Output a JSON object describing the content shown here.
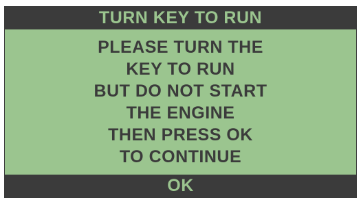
{
  "screen": {
    "title": "TURN KEY TO RUN",
    "message_lines": [
      "PLEASE TURN THE",
      "KEY TO RUN",
      "BUT DO NOT START",
      "THE ENGINE",
      "THEN PRESS OK",
      "TO CONTINUE"
    ],
    "ok_label": "OK"
  },
  "colors": {
    "screen_background": "#9bc58f",
    "bar_background": "#3b3b3b",
    "text_dark": "#3b3b3b",
    "text_light": "#9bc58f"
  }
}
